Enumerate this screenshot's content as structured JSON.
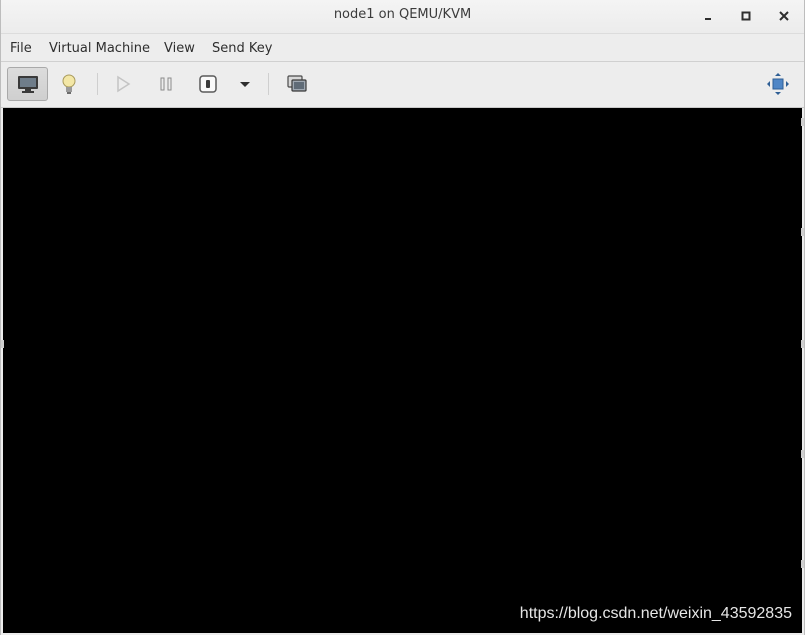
{
  "window": {
    "title": "node1 on QEMU/KVM",
    "controls": {
      "minimize": "minimize-icon",
      "maximize": "maximize-icon",
      "close": "close-icon"
    }
  },
  "menubar": {
    "items": [
      {
        "label": "File"
      },
      {
        "label": "Virtual Machine"
      },
      {
        "label": "View"
      },
      {
        "label": "Send Key"
      }
    ]
  },
  "toolbar": {
    "buttons": [
      {
        "icon": "monitor-icon",
        "active": true
      },
      {
        "icon": "lightbulb-icon",
        "active": false
      },
      {
        "icon": "play-icon",
        "active": false
      },
      {
        "icon": "pause-icon",
        "active": false
      },
      {
        "icon": "power-icon",
        "active": false
      },
      {
        "icon": "dropdown-arrow-icon",
        "active": false
      },
      {
        "icon": "snapshots-icon",
        "active": false
      },
      {
        "icon": "fullscreen-icon",
        "active": false
      }
    ]
  },
  "console": {
    "background": "#000000"
  },
  "watermark": {
    "text": "https://blog.csdn.net/weixin_43592835"
  }
}
